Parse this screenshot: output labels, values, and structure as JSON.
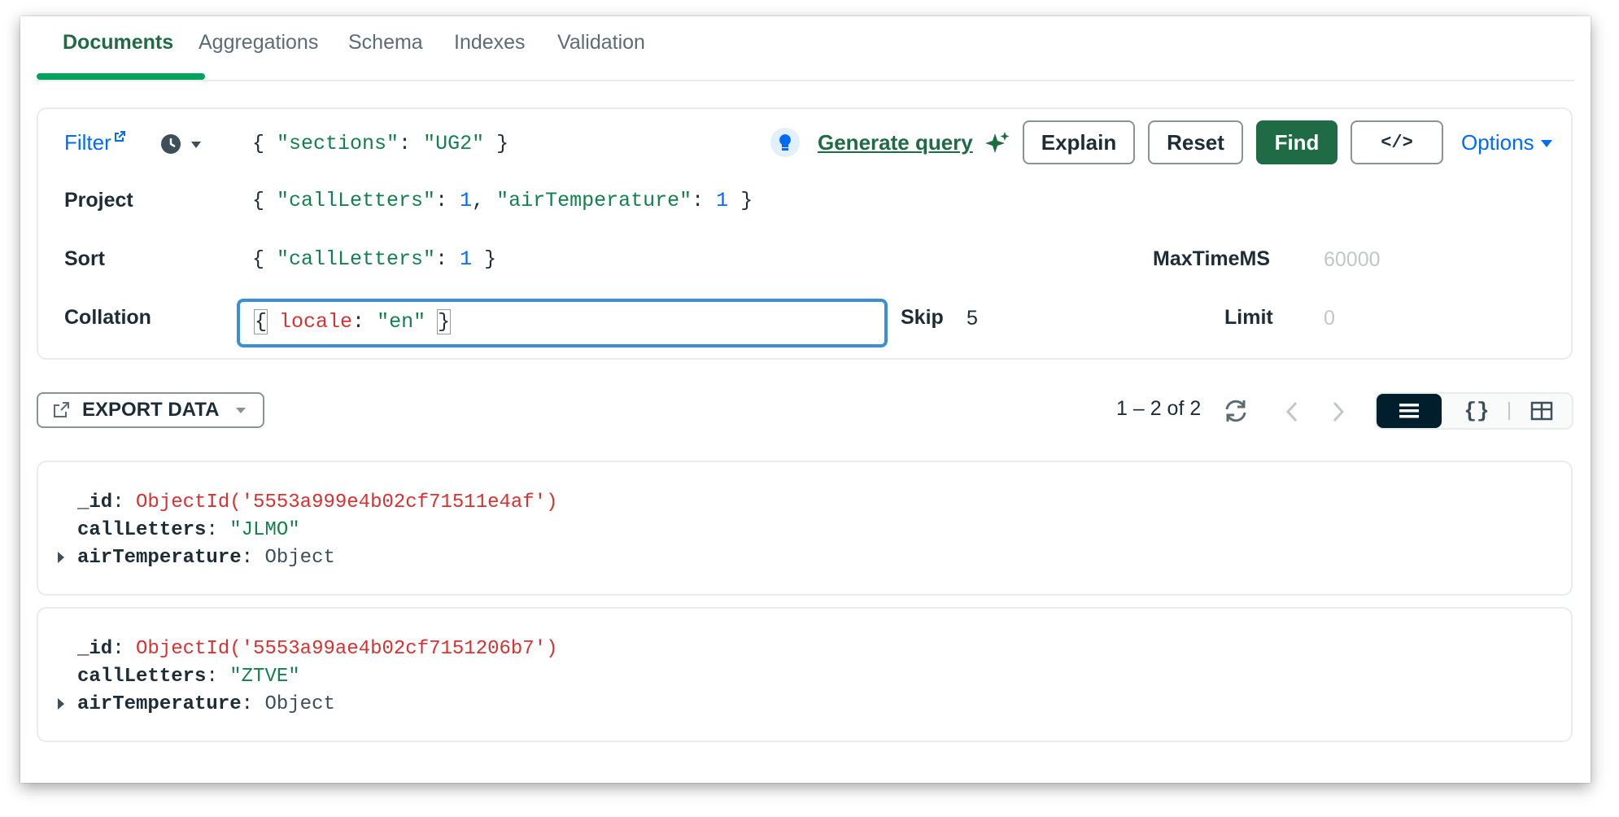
{
  "tabs": [
    {
      "label": "Documents"
    },
    {
      "label": "Aggregations"
    },
    {
      "label": "Schema"
    },
    {
      "label": "Indexes"
    },
    {
      "label": "Validation"
    }
  ],
  "query": {
    "filter_label": "Filter",
    "filter_value": {
      "open": "{ ",
      "key": "\"sections\"",
      "sep": ": ",
      "val": "\"UG2\"",
      "close": " }"
    },
    "project_label": "Project",
    "project_value": {
      "open": "{ ",
      "k1": "\"callLetters\"",
      "s1": ": ",
      "v1": "1",
      "comma": ", ",
      "k2": "\"airTemperature\"",
      "s2": ": ",
      "v2": "1",
      "close": " }"
    },
    "sort_label": "Sort",
    "sort_value": {
      "open": "{ ",
      "key": "\"callLetters\"",
      "sep": ": ",
      "val": "1",
      "close": " }"
    },
    "collation_label": "Collation",
    "collation_value": {
      "open": "{",
      "key": "locale",
      "sep": ": ",
      "val": "\"en\"",
      "close": "}"
    },
    "maxtime_label": "MaxTimeMS",
    "maxtime_placeholder": "60000",
    "skip_label": "Skip",
    "skip_value": "5",
    "limit_label": "Limit",
    "limit_placeholder": "0",
    "generate_query": "Generate query",
    "explain": "Explain",
    "reset": "Reset",
    "find": "Find",
    "code_label": "</>",
    "options": "Options"
  },
  "toolbar": {
    "export_label": "EXPORT DATA",
    "pagination": "1 – 2 of 2"
  },
  "documents": [
    {
      "id_key": "_id",
      "id_value": "ObjectId('5553a999e4b02cf71511e4af')",
      "f2_key": "callLetters",
      "f2_value": "\"JLMO\"",
      "f3_key": "airTemperature",
      "f3_value": "Object"
    },
    {
      "id_key": "_id",
      "id_value": "ObjectId('5553a99ae4b02cf7151206b7')",
      "f2_key": "callLetters",
      "f2_value": "\"ZTVE\"",
      "f3_key": "airTemperature",
      "f3_value": "Object"
    }
  ],
  "colors": {
    "accent_green": "#00a35c",
    "find_button": "#1e6b45",
    "link_blue": "#016bf8",
    "string_green": "#12824d",
    "key_red": "#db3030"
  }
}
